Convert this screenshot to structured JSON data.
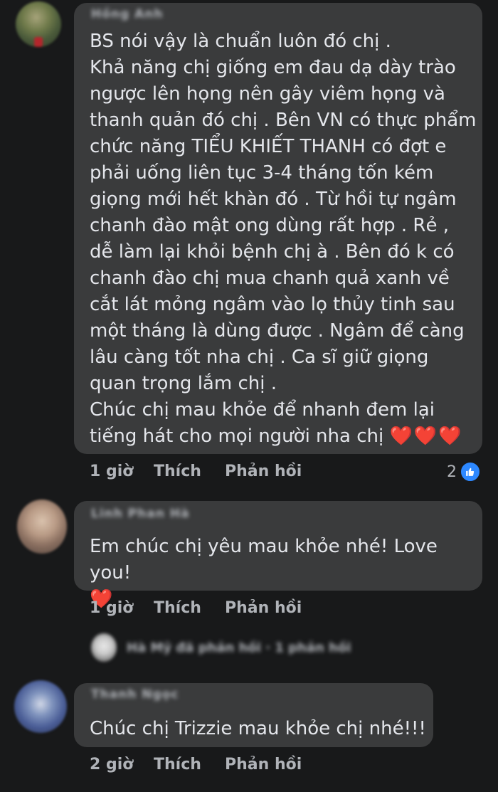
{
  "comments": [
    {
      "author": "Hồng Anh",
      "text": "BS nói vậy là chuẩn luôn đó chị .\nKhả năng chị giống em đau dạ dày trào ngược lên họng nên gây viêm họng và thanh quản đó chị . Bên VN có thực phẩm chức năng TIỂU KHIẾT THANH có đợt e phải uống liên tục 3-4 tháng tốn kém giọng mới hết khàn đó . Từ hồi tự ngâm chanh đào mật ong dùng rất hợp . Rẻ , dễ làm lại khỏi bệnh chị à . Bên đó k có chanh đào chị mua chanh quả xanh về cắt lát mỏng ngâm vào lọ thủy tinh sau một tháng là dùng được . Ngâm để càng lâu càng tốt nha chị . Ca sĩ giữ giọng quan trọng lắm chị .\nChúc chị mau khỏe để nhanh đem lại tiếng hát cho mọi người nha chị",
      "emoji": "❤️❤️❤️",
      "time": "1 giờ",
      "like_label": "Thích",
      "reply_label": "Phản hồi",
      "reaction_count": "2",
      "reaction_icon": "like-icon"
    },
    {
      "author": "Linh Phan Hà",
      "text": "Em chúc chị yêu mau khỏe nhé! Love you!",
      "emoji": "❤️",
      "time": "1 giờ",
      "like_label": "Thích",
      "reply_label": "Phản hồi"
    },
    {
      "author": "Thanh Ngọc",
      "text": "Chúc chị Trizzie mau khỏe chị nhé!!!",
      "time": "2 giờ",
      "like_label": "Thích",
      "reply_label": "Phản hồi"
    }
  ],
  "view_replies": {
    "label": "Hà Mỹ đã phản hồi · 1 phản hồi"
  },
  "colors": {
    "background": "#18191a",
    "bubble": "#3a3b3c",
    "text": "#e4e6eb",
    "secondary": "#b0b3b8",
    "like_blue": "#2d88ff",
    "heart_red": "#f02849"
  }
}
